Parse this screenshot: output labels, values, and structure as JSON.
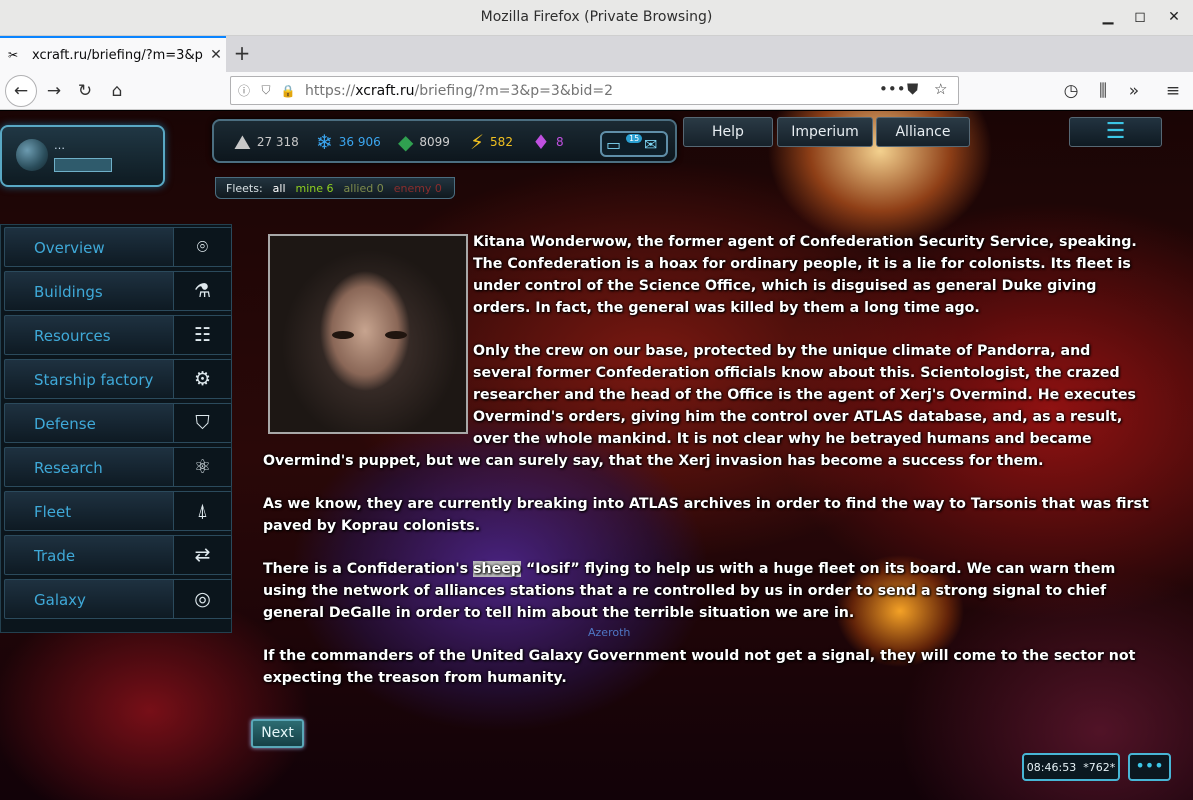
{
  "window": {
    "title": "Mozilla Firefox (Private Browsing)",
    "minimize": "▁",
    "maximize": "◻",
    "close": "✕"
  },
  "tab": {
    "label": "xcraft.ru/briefing/?m=3&p",
    "close": "✕",
    "new_tab": "+",
    "favicon": "xcraft-favicon-icon"
  },
  "navbar": {
    "url_prefix": "https://",
    "url_host": "xcraft.ru",
    "url_path": "/briefing/?m=3&p=3&bid=2",
    "more": "•••"
  },
  "resources": {
    "metal": "27 318",
    "crystal": "36 906",
    "deuterium": "8099",
    "energy": "582",
    "credits": "8",
    "message_count": "15"
  },
  "fleets": {
    "label": "Fleets:",
    "all": "all",
    "mine": "mine 6",
    "allied": "allied 0",
    "enemy": "enemy 0"
  },
  "topnav": {
    "help": "Help",
    "imperium": "Imperium",
    "alliance": "Alliance",
    "menu": "☰"
  },
  "planet": {
    "name": "…"
  },
  "sidebar": {
    "items": [
      {
        "label": "Overview",
        "icon": "⌾"
      },
      {
        "label": "Buildings",
        "icon": "⚗"
      },
      {
        "label": "Resources",
        "icon": "☷"
      },
      {
        "label": "Starship factory",
        "icon": "⚙"
      },
      {
        "label": "Defense",
        "icon": "⛉"
      },
      {
        "label": "Research",
        "icon": "⚛"
      },
      {
        "label": "Fleet",
        "icon": "⍋"
      },
      {
        "label": "Trade",
        "icon": "⇄"
      },
      {
        "label": "Galaxy",
        "icon": "◎"
      }
    ]
  },
  "briefing": {
    "p1": "Kitana Wonderwow, the former agent of Confederation Security Service, speaking. The Confederation is a hoax for ordinary people, it is a lie for colonists. Its fleet is under control of the Science Office, which is disguised as general Duke giving orders. In fact, the general was killed by them a long time ago.",
    "p2": "Only the crew on our base, protected by the unique climate of Pandorra, and several former Confederation officials know about this. Scientologist, the crazed researcher and the head of the Office is the agent of Xerj's Overmind. He executes Overmind's orders, giving him the control over ATLAS database, and, as a result, over the whole mankind. It is not clear why he betrayed humans and became Overmind's puppet, but we can surely say, that the Xerj invasion has become a success for them.",
    "p3": "As we know, they are currently breaking into ATLAS archives in order to find the way to Tarsonis that was first paved by Koprau colonists.",
    "p4_before": "There is a Confideration's ",
    "p4_highlight": "sheep",
    "p4_after": " “Iosif” flying to help us with a huge fleet on its board. We can warn them using the network of alliances stations that a re controlled by us in order to send a strong signal to chief general DeGalle in order to tell him about the terrible situation we are in.",
    "p5": "If the commanders of the United Galaxy Government would not get a signal, they will come to the sector not expecting the treason from humanity."
  },
  "next_button": "Next",
  "watermark": "Azeroth",
  "clock": {
    "time": "08:46:53",
    "server": "*762*"
  },
  "chat_button": "•••",
  "colors": {
    "accent": "#3fa9d8",
    "metal": "#c8c8c8",
    "crystal": "#3ba6f0",
    "deuterium": "#30a050",
    "energy": "#f0c020",
    "credits": "#c050e0",
    "mine": "#8fd020"
  }
}
